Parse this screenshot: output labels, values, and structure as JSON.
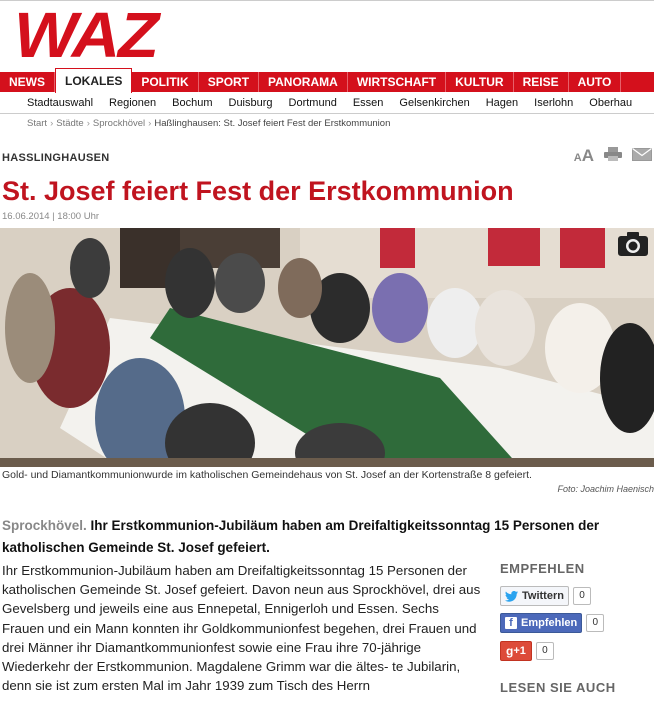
{
  "site": {
    "logo": "WAZ"
  },
  "main_nav": [
    "NEWS",
    "LOKALES",
    "POLITIK",
    "SPORT",
    "PANORAMA",
    "WIRTSCHAFT",
    "KULTUR",
    "REISE",
    "AUTO"
  ],
  "main_nav_active": "LOKALES",
  "sub_nav": [
    "Stadtauswahl",
    "Regionen",
    "Bochum",
    "Duisburg",
    "Dortmund",
    "Essen",
    "Gelsenkirchen",
    "Hagen",
    "Iserlohn",
    "Oberhau"
  ],
  "breadcrumb": {
    "start": "Start",
    "staedte": "Städte",
    "city": "Sprockhövel",
    "current": "Haßlinghausen: St. Josef feiert Fest der Erstkommunion"
  },
  "article": {
    "kicker": "HASSLINGHAUSEN",
    "font_small": "A",
    "font_large": "A",
    "title": "St. Josef feiert Fest der Erstkommunion",
    "date": "16.06.2014 | 18:00 Uhr",
    "caption": "Gold- und Diamantkommunionwurde im katholischen Gemeindehaus von St. Josef an der Kortenstraße 8 gefeiert.",
    "credit": "Foto: Joachim Haenisch",
    "lead_location": "Sprockhövel.",
    "lead_text": "Ihr Erstkommunion-Jubiläum haben am Dreifaltigkeitssonntag 15 Personen der katholischen Gemeinde St. Josef gefeiert.",
    "body": "Ihr Erstkommunion-Jubiläum haben am Dreifaltigkeitssonntag 15 Personen der katholischen Gemeinde St. Josef gefeiert. Davon neun aus Sprockhövel, drei aus Gevelsberg und jeweils eine aus Ennepetal, Ennigerloh und Essen. Sechs Frauen und ein Mann konnten ihr Goldkommunionfest begehen, drei Frauen und drei Männer ihr Diamantkommunionfest sowie eine Frau ihre 70-jährige Wiederkehr der Erstkommunion. Magdalene Grimm war die ältes- te Jubilarin, denn sie ist zum ersten Mal im Jahr 1939 zum Tisch des Herrn"
  },
  "sidebar": {
    "recommend_heading": "EMPFEHLEN",
    "twitter_label": "Twittern",
    "twitter_count": "0",
    "facebook_label": "Empfehlen",
    "facebook_count": "0",
    "gplus_label": "+1",
    "gplus_count": "0",
    "read_also_heading": "LESEN SIE AUCH"
  },
  "colors": {
    "brand_red": "#d4101c",
    "title_red": "#c0141f",
    "table_green": "#2f6b3a"
  }
}
